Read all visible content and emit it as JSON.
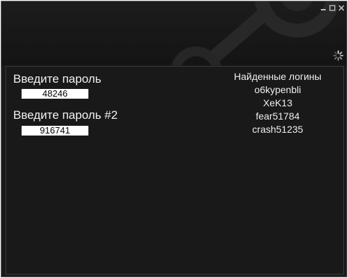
{
  "window": {
    "controls": [
      "minimize-icon",
      "maximize-icon",
      "close-icon"
    ],
    "loading_icon": "spinner-icon",
    "background_logo": "steam-logo"
  },
  "form": {
    "password_label": "Введите пароль",
    "password_value": "48246",
    "password2_label": "Введите пароль #2",
    "password2_value": "916741"
  },
  "logins": {
    "header": "Найденные логины",
    "items": [
      "o6kypenbli",
      "XeK13",
      "fear51784",
      "crash51235"
    ]
  },
  "colors": {
    "background": "#1b1b1b",
    "text": "#f2f2f2",
    "input_bg": "#ffffff"
  }
}
